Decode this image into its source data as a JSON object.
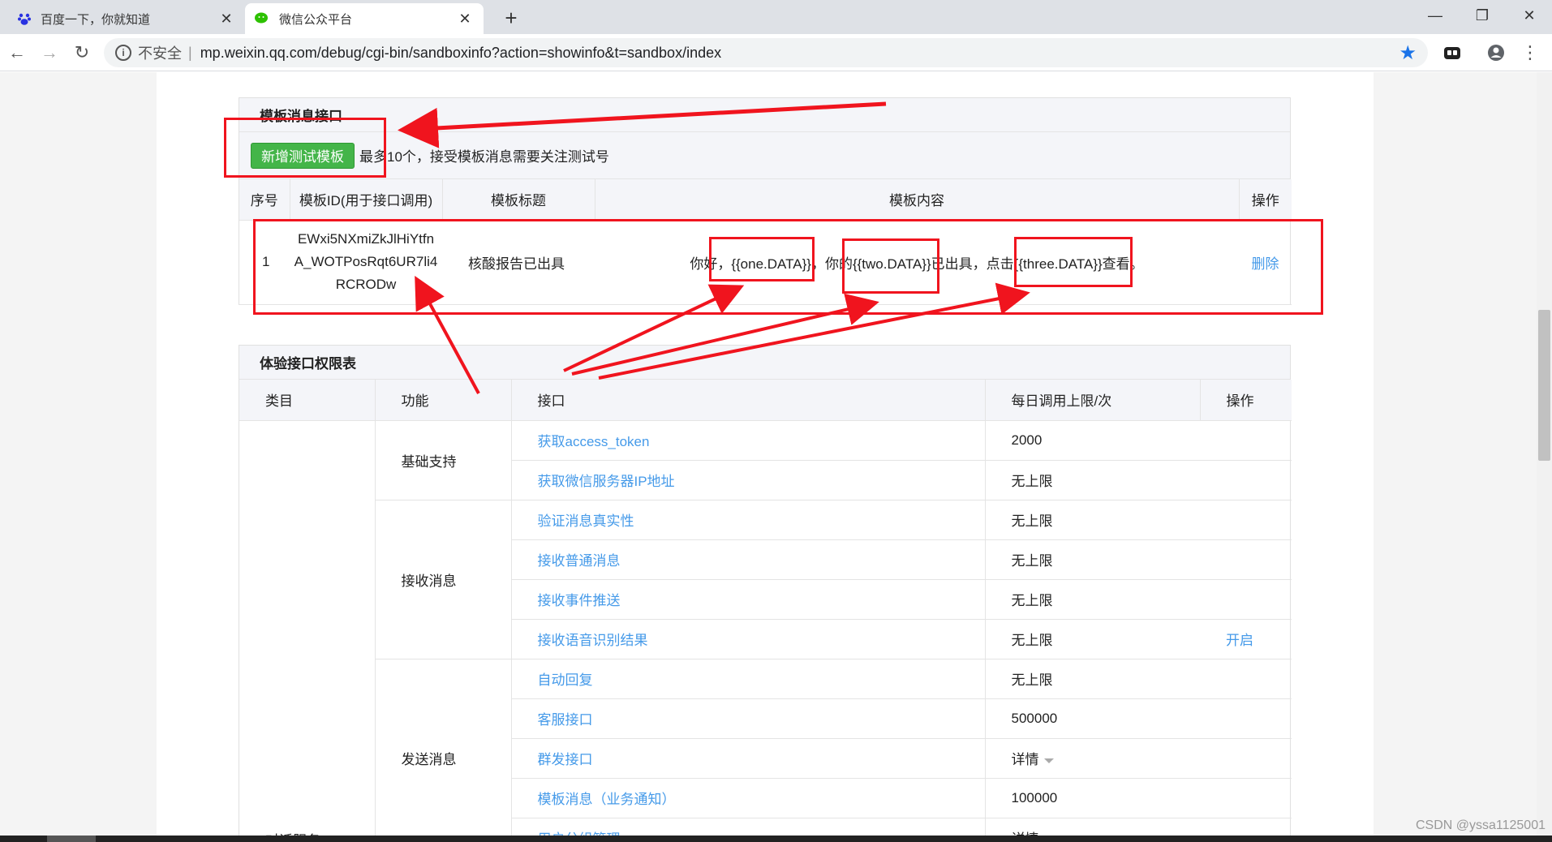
{
  "browser": {
    "tabs": [
      {
        "title": "百度一下，你就知道",
        "icon": "baidu-paw-icon",
        "active": false
      },
      {
        "title": "微信公众平台",
        "icon": "wechat-icon",
        "active": true
      }
    ],
    "address": {
      "insecure_label": "不安全",
      "separator": "|",
      "url": "mp.weixin.qq.com/debug/cgi-bin/sandboxinfo?action=showinfo&t=sandbox/index"
    }
  },
  "template_section": {
    "title": "模板消息接口",
    "add_button": "新增测试模板",
    "hint": "最多10个，接受模板消息需要关注测试号",
    "columns": [
      "序号",
      "模板ID(用于接口调用)",
      "模板标题",
      "模板内容",
      "操作"
    ],
    "rows": [
      {
        "index": "1",
        "id_line1": "EWxi5NXmiZkJlHiYtfn",
        "id_line2": "A_WOTPosRqt6UR7li4",
        "id_line3": "RCRODw",
        "title": "核酸报告已出具",
        "content_1": "你好，",
        "content_var1": "{{one.DATA}}",
        "content_2": "，你的",
        "content_var2": "{{two.DATA}}",
        "content_3": "已出具，点击",
        "content_var3": "{{three.DATA}}",
        "content_4": "查看。",
        "action": "删除"
      }
    ]
  },
  "perm_section": {
    "title": "体验接口权限表",
    "columns": [
      "类目",
      "功能",
      "接口",
      "每日调用上限/次",
      "操作"
    ],
    "category": "对话服务",
    "groups": [
      {
        "function": "基础支持",
        "rows": [
          {
            "api": "获取access_token",
            "limit": "2000",
            "action": ""
          },
          {
            "api": "获取微信服务器IP地址",
            "limit": "无上限",
            "action": ""
          }
        ]
      },
      {
        "function": "接收消息",
        "rows": [
          {
            "api": "验证消息真实性",
            "limit": "无上限",
            "action": ""
          },
          {
            "api": "接收普通消息",
            "limit": "无上限",
            "action": ""
          },
          {
            "api": "接收事件推送",
            "limit": "无上限",
            "action": ""
          },
          {
            "api": "接收语音识别结果",
            "limit": "无上限",
            "action": "开启"
          }
        ]
      },
      {
        "function": "发送消息",
        "rows": [
          {
            "api": "自动回复",
            "limit": "无上限",
            "action": ""
          },
          {
            "api": "客服接口",
            "limit": "500000",
            "action": ""
          },
          {
            "api": "群发接口",
            "limit": "详情",
            "action": ""
          },
          {
            "api": "模板消息（业务通知）",
            "limit": "100000",
            "action": ""
          },
          {
            "api": "用户分组管理",
            "limit": "详情",
            "action": ""
          }
        ]
      }
    ]
  },
  "watermark": "CSDN @yssa1125001",
  "colors": {
    "accent_green": "#44b549",
    "link_blue": "#459ae9",
    "annotation_red": "#f0141e"
  }
}
